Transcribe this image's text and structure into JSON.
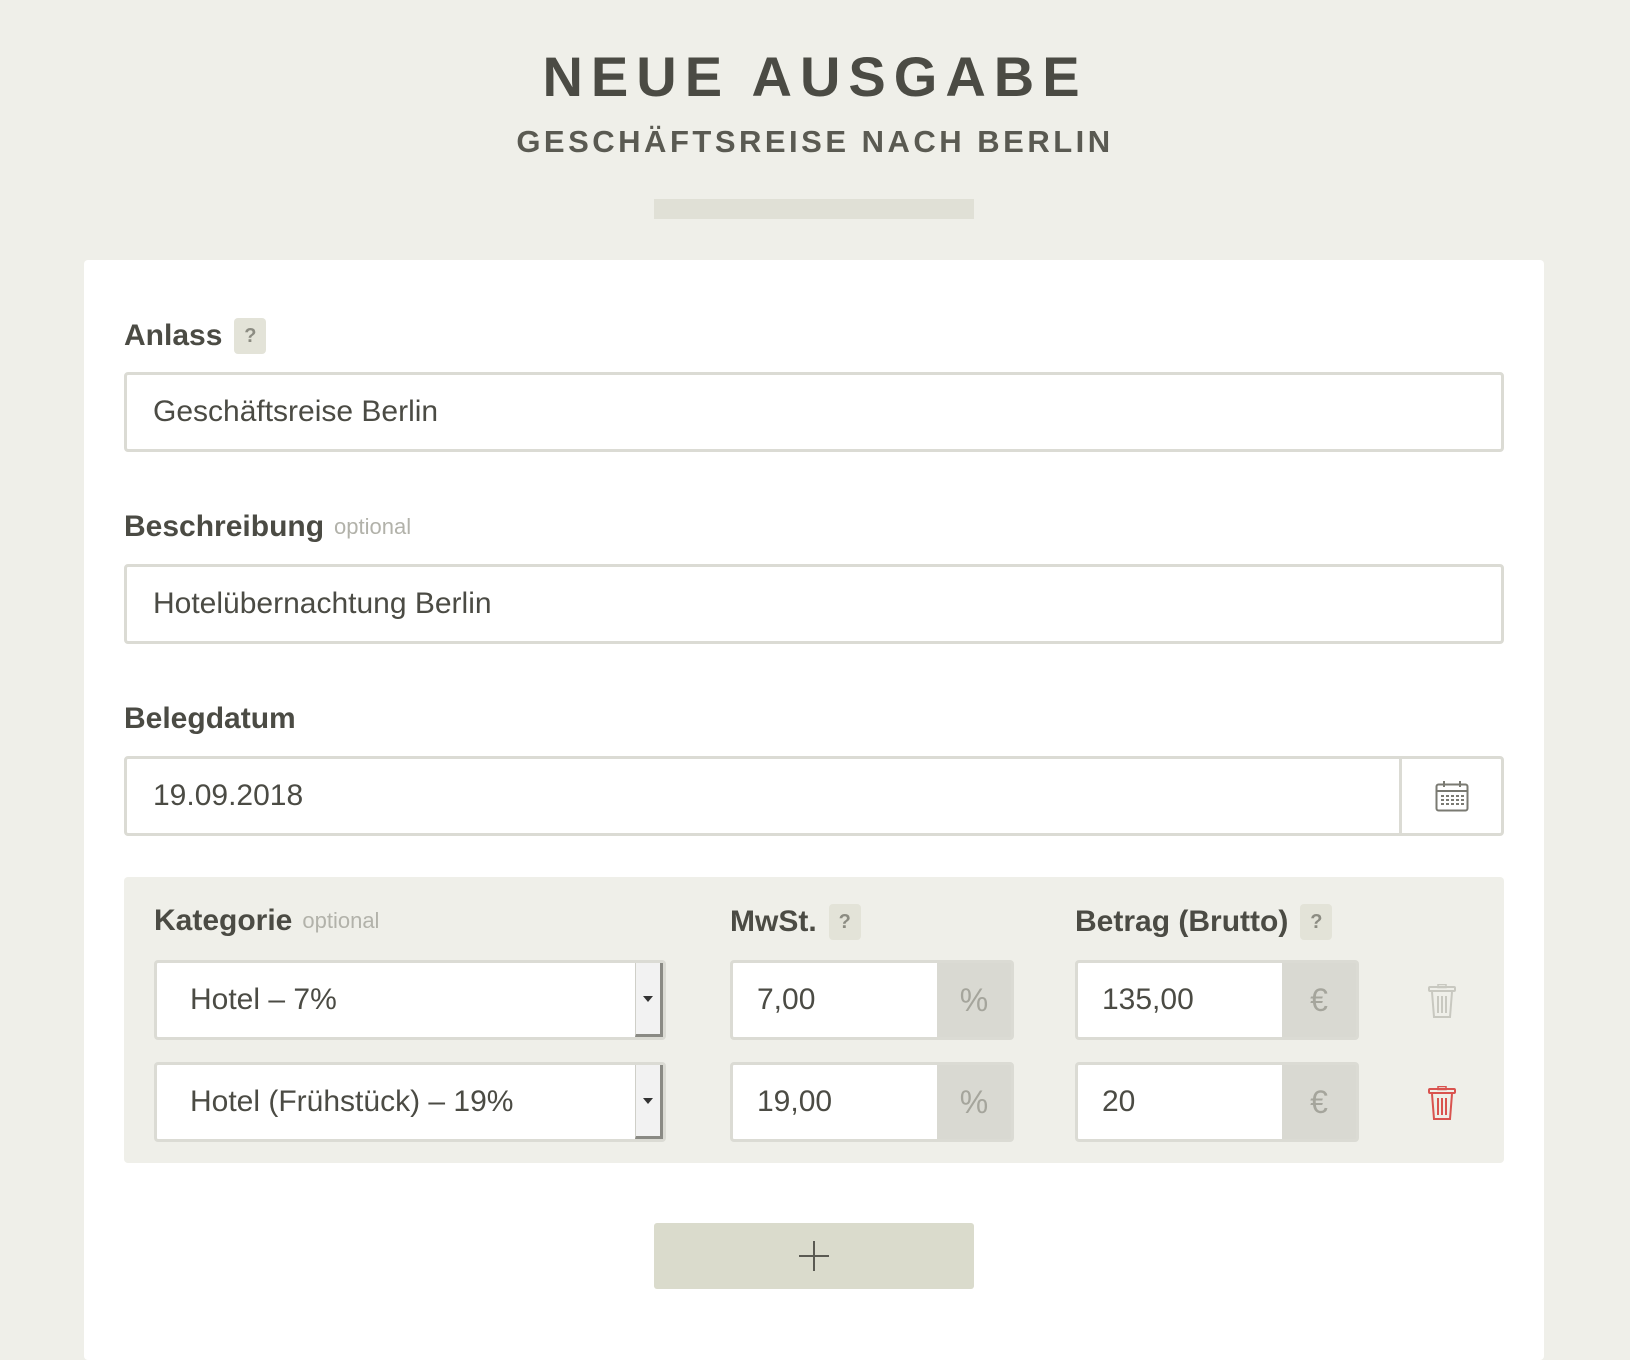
{
  "header": {
    "title": "NEUE AUSGABE",
    "subtitle": "GESCHÄFTSREISE NACH BERLIN"
  },
  "form": {
    "anlass": {
      "label": "Anlass",
      "help": "?",
      "value": "Geschäftsreise Berlin"
    },
    "beschreibung": {
      "label": "Beschreibung",
      "optional": "optional",
      "value": "Hotelübernachtung Berlin"
    },
    "belegdatum": {
      "label": "Belegdatum",
      "value": "19.09.2018",
      "calendar_icon": "calendar-icon"
    }
  },
  "items": {
    "kategorie_label": "Kategorie",
    "kategorie_optional": "optional",
    "mwst_label": "MwSt.",
    "betrag_label": "Betrag (Brutto)",
    "help": "?",
    "rows": [
      {
        "kategorie": "Hotel – 7%",
        "mwst": "7,00",
        "mwst_unit": "%",
        "betrag": "135,00",
        "betrag_unit": "€",
        "delete_enabled": false
      },
      {
        "kategorie": "Hotel (Frühstück) – 19%",
        "mwst": "19,00",
        "mwst_unit": "%",
        "betrag": "20",
        "betrag_unit": "€",
        "delete_enabled": true
      }
    ]
  },
  "add_button": {
    "icon": "plus-icon"
  },
  "colors": {
    "background": "#efefe9",
    "card": "#ffffff",
    "text": "#4b4b44",
    "delete_active": "#d9534f",
    "delete_inactive": "#c8c8c0",
    "add_button": "#dadbcc"
  }
}
